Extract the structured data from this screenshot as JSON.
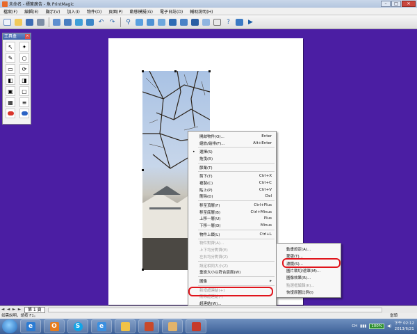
{
  "window": {
    "title": "未命名 - 標簽廣告 - 魚 PrintMagic",
    "min_label": "–",
    "max_label": "□",
    "close_label": "✕"
  },
  "menubar": [
    "檔案(F)",
    "編輯(E)",
    "顯示(V)",
    "加入(I)",
    "物件(O)",
    "頁面(P)",
    "動態模擬(G)",
    "電子日誌(D)",
    "輔助說明(H)"
  ],
  "toolbar": {
    "icons": [
      "new-doc-icon",
      "open-icon",
      "save-icon",
      "print-icon",
      "print-preview-icon",
      "scan-icon",
      "import-icon",
      "export-icon",
      "undo-icon",
      "redo-icon",
      "zoom-icon",
      "image-icon",
      "image-edit-icon",
      "photo-icon",
      "cut-icon",
      "copy-icon",
      "paste-icon",
      "delete-icon",
      "calendar-icon",
      "help-icon",
      "tool-icon",
      "play-icon"
    ]
  },
  "toolbox": {
    "title": "工具盒",
    "close_label": "×",
    "tools": [
      "select-tool-icon",
      "magic-wand-icon",
      "pen-tool-icon",
      "ellipse-tool-icon",
      "rect-tool-icon",
      "rotate-tool-icon",
      "front-tool-icon",
      "back-tool-icon",
      "group-tool-icon",
      "ungroup-tool-icon",
      "frame-tool-icon",
      "align-tool-icon",
      "red-color-icon",
      "blue-color-icon"
    ]
  },
  "context_menu": {
    "items": [
      {
        "label": "開啟物件(O)...",
        "shortcut": "Enter",
        "disabled": false
      },
      {
        "label": "縮放/繪排(F)...",
        "shortcut": "Alt+Enter",
        "disabled": false
      },
      {
        "sep": true
      },
      {
        "label": "選擇(S)",
        "shortcut": "",
        "disabled": false,
        "bullet": "•"
      },
      {
        "label": "拖曳(R)",
        "shortcut": "",
        "disabled": false
      },
      {
        "sep": true
      },
      {
        "label": "節業(T)",
        "shortcut": "",
        "disabled": false
      },
      {
        "sep": true
      },
      {
        "label": "剪下(T)",
        "shortcut": "Ctrl+X",
        "disabled": false
      },
      {
        "label": "複製(C)",
        "shortcut": "Ctrl+C",
        "disabled": false
      },
      {
        "label": "貼上(P)",
        "shortcut": "Ctrl+V",
        "disabled": false
      },
      {
        "label": "刪除(D)",
        "shortcut": "Del",
        "disabled": false
      },
      {
        "sep": true
      },
      {
        "label": "移至頂層(F)",
        "shortcut": "Ctrl+Plus",
        "disabled": false
      },
      {
        "label": "移至底層(B)",
        "shortcut": "Ctrl+Minus",
        "disabled": false
      },
      {
        "label": "上移一層(U)",
        "shortcut": "Plus",
        "disabled": false
      },
      {
        "label": "下移一層(D)",
        "shortcut": "Minus",
        "disabled": false
      },
      {
        "sep": true
      },
      {
        "label": "物件上鎖(L)",
        "shortcut": "Ctrl+L",
        "disabled": false
      },
      {
        "sep": true
      },
      {
        "label": "物件對齊(A)...",
        "shortcut": "",
        "disabled": true
      },
      {
        "label": "上下均分對齊(E)",
        "shortcut": "",
        "disabled": true
      },
      {
        "label": "左右均分對齊(Z)",
        "shortcut": "",
        "disabled": true
      },
      {
        "sep": true
      },
      {
        "label": "設定相同大小(Z)",
        "shortcut": "",
        "disabled": true
      },
      {
        "label": "重設大小以符合頁面(W)",
        "shortcut": "",
        "disabled": false
      },
      {
        "sep": true
      },
      {
        "label": "圖像",
        "shortcut": "",
        "disabled": false
      },
      {
        "sep": true
      },
      {
        "label": "新增超連結(+)",
        "shortcut": "",
        "disabled": true
      },
      {
        "label": "刪除超連結(-)",
        "shortcut": "",
        "disabled": true
      },
      {
        "label": "超連結(W)...",
        "shortcut": "",
        "disabled": false
      }
    ]
  },
  "submenu": {
    "items": [
      {
        "label": "動畫設定(A)...",
        "disabled": false
      },
      {
        "label": "蒙版(T)...",
        "disabled": false
      },
      {
        "label": "濾鏡(S)...",
        "disabled": false
      },
      {
        "label": "圖片裁切/遮罩(M)...",
        "disabled": false
      },
      {
        "label": "圖像效果(R)...",
        "disabled": false
      },
      {
        "label": "點選框編輯(K)...",
        "disabled": true
      },
      {
        "label": "恢復原圖比例(I)",
        "disabled": false
      }
    ]
  },
  "pagetabs": {
    "first": "◄",
    "prev": "◄",
    "next": "►",
    "last": "►",
    "tab_label": "第 1 頁"
  },
  "statusbar": {
    "help": "如需說明，請按 F1。",
    "right": "當頭"
  },
  "taskbar": {
    "apps": [
      "ie-icon",
      "outlook-icon",
      "skype-icon",
      "ie2-icon",
      "folder-icon",
      "presentation-icon",
      "paint-icon",
      "printmagic-icon"
    ],
    "lang": "CH",
    "battery": "100%",
    "time": "下午 02:12",
    "date": "2013/6/21"
  }
}
